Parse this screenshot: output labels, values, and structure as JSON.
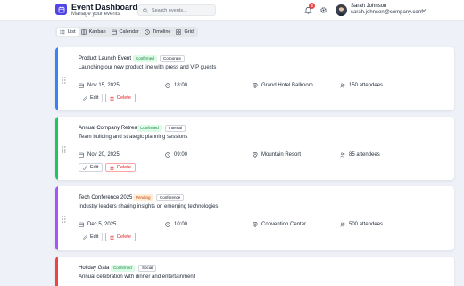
{
  "header": {
    "title": "Event Dashboard",
    "subtitle": "Manage your events",
    "search_placeholder": "Search events...",
    "notification_count": "3",
    "user_name": "Sarah Johnson",
    "user_email": "sarah.johnson@company.com"
  },
  "view_tabs": [
    {
      "label": "List",
      "icon": "list-icon",
      "active": true
    },
    {
      "label": "Kanban",
      "icon": "kanban-icon",
      "active": false
    },
    {
      "label": "Calendar",
      "icon": "calendar-icon",
      "active": false
    },
    {
      "label": "Timeline",
      "icon": "clock-icon",
      "active": false
    },
    {
      "label": "Grid",
      "icon": "grid-icon",
      "active": false
    }
  ],
  "events": [
    {
      "title": "Product Launch Event",
      "status": "Confirmed",
      "category": "Corporate",
      "description": "Launching our new product line with press and VIP guests",
      "date": "Nov 15, 2025",
      "time": "18:00",
      "location": "Grand Hotel Ballroom",
      "attendees": "150 attendees",
      "accent_color": "#3b82f6"
    },
    {
      "title": "Annual Company Retreat",
      "status": "Confirmed",
      "category": "Internal",
      "description": "Team building and strategic planning sessions",
      "date": "Nov 20, 2025",
      "time": "09:00",
      "location": "Mountain Resort",
      "attendees": "85 attendees",
      "accent_color": "#22c55e"
    },
    {
      "title": "Tech Conference 2025",
      "status": "Pending",
      "category": "Conference",
      "description": "Industry leaders sharing insights on emerging technologies",
      "date": "Dec 5, 2025",
      "time": "10:00",
      "location": "Convention Center",
      "attendees": "500 attendees",
      "accent_color": "#a855f7"
    },
    {
      "title": "Holiday Gala",
      "status": "Confirmed",
      "category": "Social",
      "description": "Annual celebration with dinner and entertainment",
      "accent_color": "#ef4444"
    }
  ],
  "actions": {
    "edit_label": "Edit",
    "delete_label": "Delete"
  },
  "colors": {
    "brand": "#4f46e5",
    "background": "#eef1f7",
    "status_confirmed": "#15803d",
    "status_pending": "#c2410c",
    "danger": "#dc2626"
  }
}
